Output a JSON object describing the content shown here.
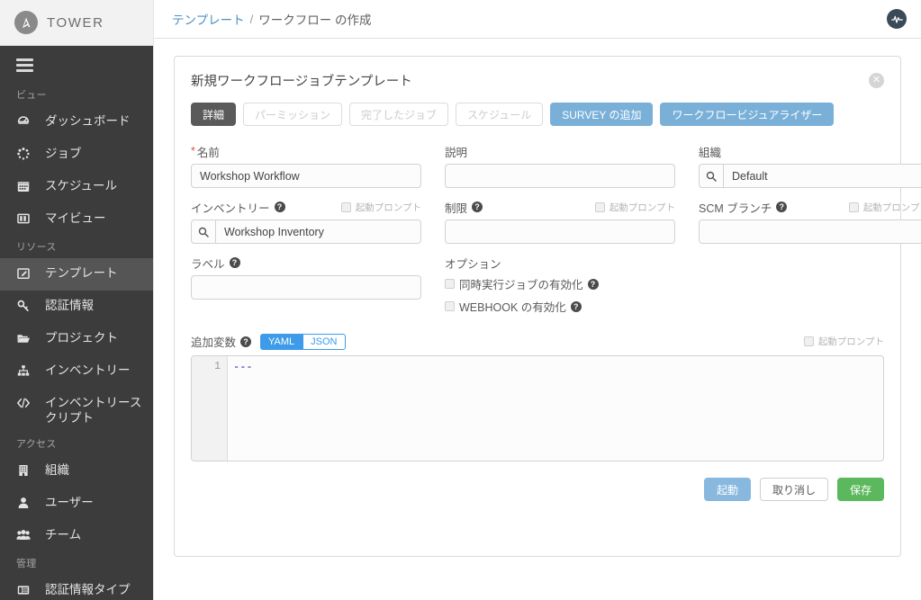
{
  "brand": {
    "name": "TOWER",
    "logo_icon": "ansible-logo-icon"
  },
  "sidebar": {
    "menu_toggle_icon": "hamburger-menu-icon",
    "sections": [
      {
        "title": "ビュー",
        "items": [
          {
            "label": "ダッシュボード",
            "icon": "dashboard-gauge-icon",
            "active": false
          },
          {
            "label": "ジョブ",
            "icon": "jobs-spinner-icon",
            "active": false
          },
          {
            "label": "スケジュール",
            "icon": "calendar-icon",
            "active": false
          },
          {
            "label": "マイビュー",
            "icon": "columns-view-icon",
            "active": false
          }
        ]
      },
      {
        "title": "リソース",
        "items": [
          {
            "label": "テンプレート",
            "icon": "template-pencil-icon",
            "active": true
          },
          {
            "label": "認証情報",
            "icon": "key-icon",
            "active": false
          },
          {
            "label": "プロジェクト",
            "icon": "folder-open-icon",
            "active": false
          },
          {
            "label": "インベントリー",
            "icon": "sitemap-icon",
            "active": false
          },
          {
            "label": "インベントリースクリプト",
            "icon": "code-brackets-icon",
            "active": false
          }
        ]
      },
      {
        "title": "アクセス",
        "items": [
          {
            "label": "組織",
            "icon": "building-icon",
            "active": false
          },
          {
            "label": "ユーザー",
            "icon": "user-icon",
            "active": false
          },
          {
            "label": "チーム",
            "icon": "users-group-icon",
            "active": false
          }
        ]
      },
      {
        "title": "管理",
        "items": [
          {
            "label": "認証情報タイプ",
            "icon": "credential-type-list-icon",
            "active": false
          }
        ]
      }
    ]
  },
  "topbar": {
    "breadcrumb_link": "テンプレート",
    "breadcrumb_separator": "/",
    "breadcrumb_current": "ワークフロー の作成",
    "activity_icon": "activity-stream-icon"
  },
  "panel": {
    "title": "新規ワークフロージョブテンプレート",
    "close_icon": "close-icon",
    "close_glyph": "✕"
  },
  "tabs": [
    {
      "label": "詳細",
      "state": "selected"
    },
    {
      "label": "パーミッション",
      "state": "disabled"
    },
    {
      "label": "完了したジョブ",
      "state": "disabled"
    },
    {
      "label": "スケジュール",
      "state": "disabled"
    },
    {
      "label": "SURVEY の追加",
      "state": "primary"
    },
    {
      "label": "ワークフロービジュアライザー",
      "state": "primary"
    }
  ],
  "form": {
    "prompt_on_launch_label": "起動プロンプト",
    "search_icon": "search-icon",
    "help_icon": "help-circle-icon",
    "required_marker": "*",
    "name": {
      "label": "名前",
      "value": "Workshop Workflow",
      "placeholder": ""
    },
    "description": {
      "label": "説明",
      "value": "",
      "placeholder": ""
    },
    "organization": {
      "label": "組織",
      "value": "Default",
      "placeholder": ""
    },
    "inventory": {
      "label": "インベントリー",
      "value": "Workshop Inventory",
      "placeholder": ""
    },
    "limit": {
      "label": "制限",
      "value": "",
      "placeholder": ""
    },
    "scm_branch": {
      "label": "SCM ブランチ",
      "value": "",
      "placeholder": ""
    },
    "labels": {
      "label": "ラベル",
      "value": "",
      "placeholder": ""
    },
    "options": {
      "label": "オプション",
      "items": [
        {
          "label": "同時実行ジョブの有効化",
          "checked": false
        },
        {
          "label": "WEBHOOK の有効化",
          "checked": false
        }
      ]
    },
    "extra_vars": {
      "label": "追加変数",
      "format_yaml": "YAML",
      "format_json": "JSON",
      "active_format": "YAML",
      "line_number": "1",
      "content": "---"
    }
  },
  "footer": {
    "launch_label": "起動",
    "cancel_label": "取り消し",
    "save_label": "保存"
  },
  "colors": {
    "sidebar_bg": "#3c3c3c",
    "sidebar_active": "#555555",
    "accent_blue": "#7ab0d8",
    "toggle_blue": "#3d9be9",
    "save_green": "#5cb85c",
    "link_blue": "#4a90c4",
    "required_red": "#d9534f"
  }
}
